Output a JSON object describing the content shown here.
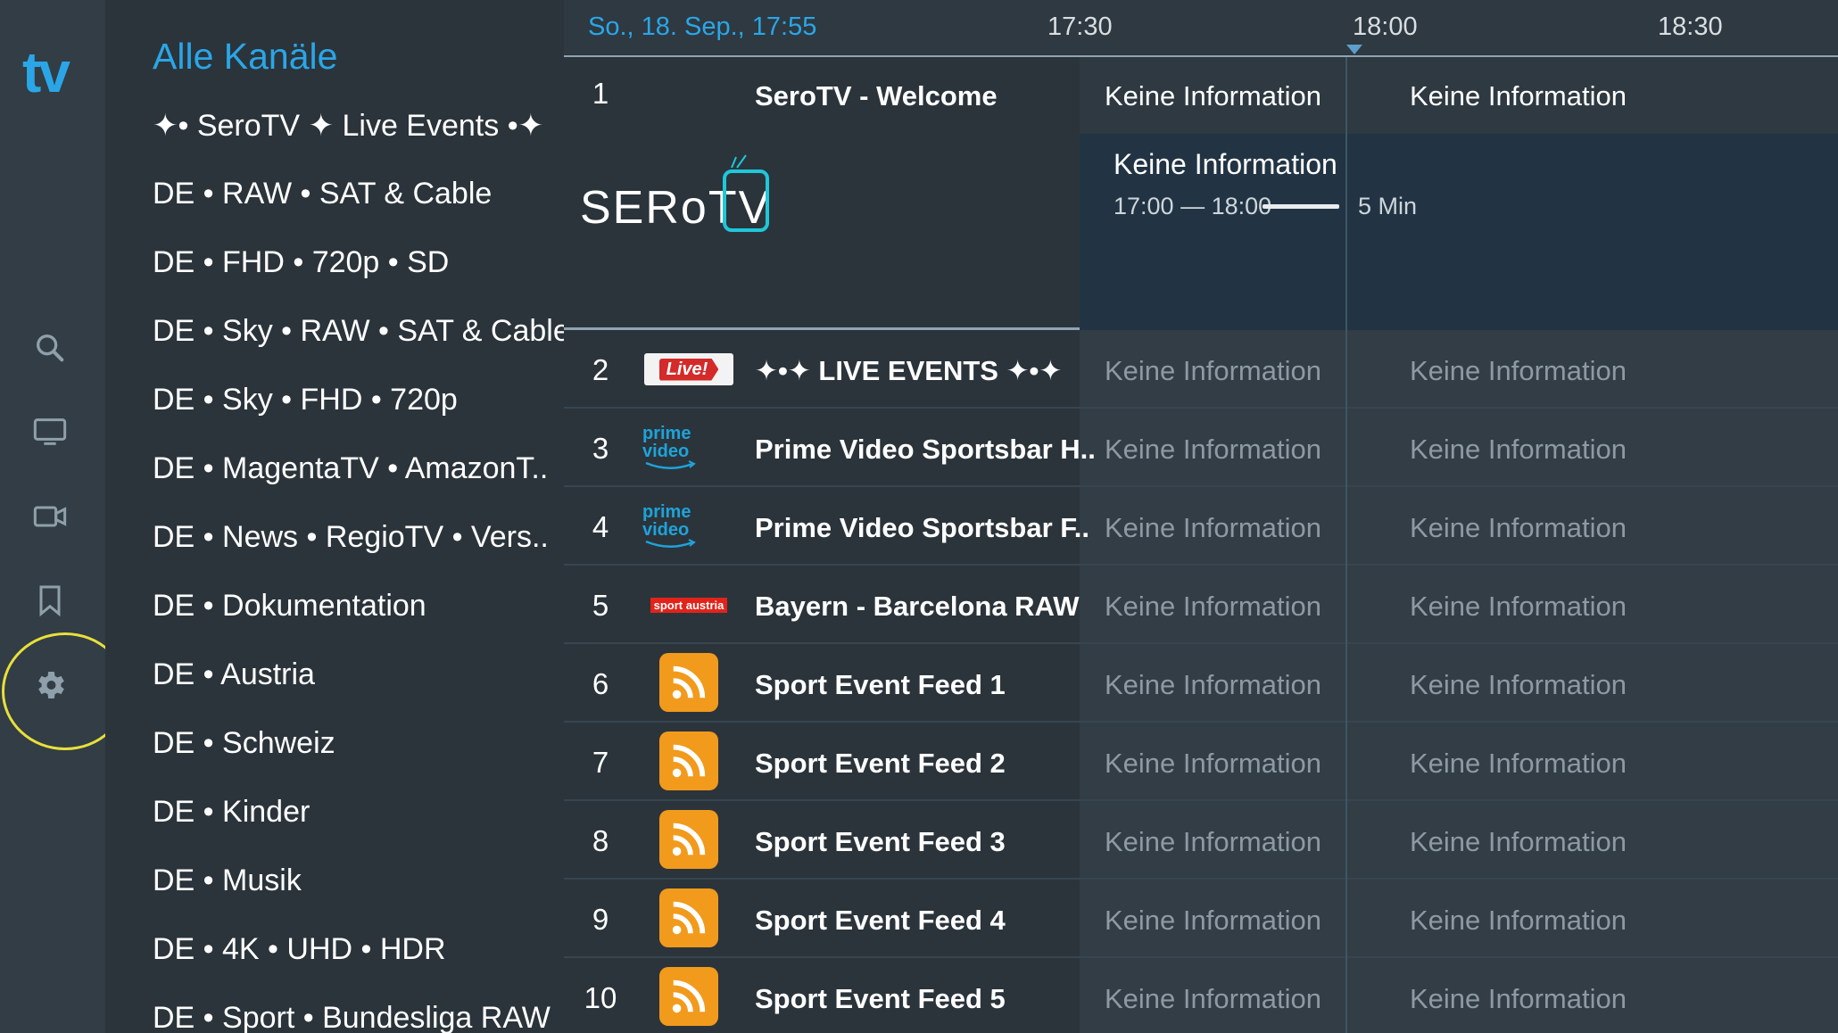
{
  "app": {
    "logo_text": "tv"
  },
  "rail": {
    "items": [
      {
        "icon": "search-icon"
      },
      {
        "icon": "tv-icon"
      },
      {
        "icon": "video-camera-icon"
      },
      {
        "icon": "bookmark-icon"
      },
      {
        "icon": "gear-icon",
        "focused": true
      }
    ]
  },
  "categories": {
    "title": "Alle Kanäle",
    "items": [
      "✦• SeroTV ✦ Live Events •✦",
      "DE • RAW • SAT & Cable",
      "DE • FHD • 720p • SD",
      "DE • Sky • RAW • SAT & Cable",
      "DE • Sky • FHD • 720p",
      "DE • MagentaTV • AmazonT..",
      "DE • News • RegioTV • Vers..",
      "DE • Dokumentation",
      "DE • Austria",
      "DE • Schweiz",
      "DE • Kinder",
      "DE • Musik",
      "DE • 4K • UHD • HDR",
      "DE • Sport • Bundesliga RAW"
    ]
  },
  "timebar": {
    "date": "So., 18. Sep., 17:55",
    "ticks": [
      "17:30",
      "18:00",
      "18:30"
    ]
  },
  "channels": [
    {
      "number": "1",
      "name": "SeroTV - Welcome",
      "logo": "serotv-logo",
      "logo_text": "SERoTV",
      "programs": [
        "Keine Information",
        "Keine Information"
      ],
      "detail": {
        "title": "Keine Information",
        "time": "17:00 — 18:00",
        "remaining": "5 Min",
        "progress": 0.92
      }
    },
    {
      "number": "2",
      "name": "✦•✦ LIVE EVENTS ✦•✦",
      "logo": "live-logo",
      "logo_text": "Live!",
      "programs": [
        "Keine Information",
        "Keine Information"
      ]
    },
    {
      "number": "3",
      "name": "Prime Video Sportsbar H..",
      "logo": "prime-video-logo",
      "logo_text": "prime video",
      "programs": [
        "Keine Information",
        "Keine Information"
      ]
    },
    {
      "number": "4",
      "name": "Prime Video Sportsbar F..",
      "logo": "prime-video-logo",
      "logo_text": "prime video",
      "programs": [
        "Keine Information",
        "Keine Information"
      ]
    },
    {
      "number": "5",
      "name": "Bayern - Barcelona RAW",
      "logo": "sport-austria-logo",
      "logo_text": "sport austria",
      "programs": [
        "Keine Information",
        "Keine Information"
      ]
    },
    {
      "number": "6",
      "name": "Sport Event Feed 1",
      "logo": "rss-icon",
      "programs": [
        "Keine Information",
        "Keine Information"
      ]
    },
    {
      "number": "7",
      "name": "Sport Event Feed 2",
      "logo": "rss-icon",
      "programs": [
        "Keine Information",
        "Keine Information"
      ]
    },
    {
      "number": "8",
      "name": "Sport Event Feed 3",
      "logo": "rss-icon",
      "programs": [
        "Keine Information",
        "Keine Information"
      ]
    },
    {
      "number": "9",
      "name": "Sport Event Feed 4",
      "logo": "rss-icon",
      "programs": [
        "Keine Information",
        "Keine Information"
      ]
    },
    {
      "number": "10",
      "name": "Sport Event Feed 5",
      "logo": "rss-icon",
      "programs": [
        "Keine Information",
        "Keine Information"
      ]
    }
  ],
  "colors": {
    "accent": "#2aa6e8",
    "focus_ring": "#e8e03a",
    "rss": "#f29a1c"
  }
}
